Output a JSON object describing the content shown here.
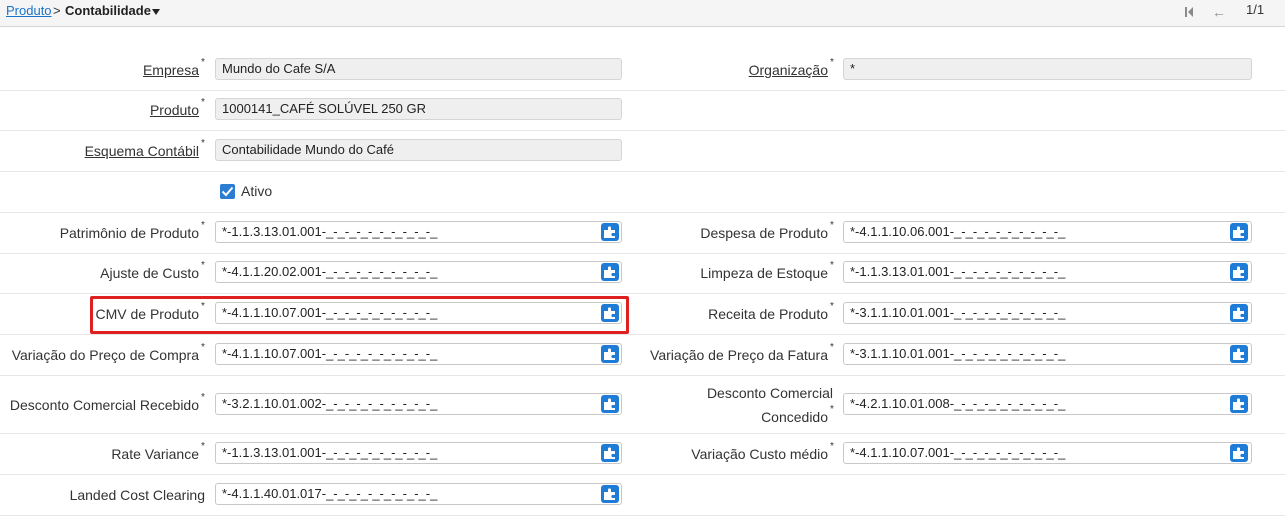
{
  "breadcrumb": {
    "root": "Produto",
    "separator": ">",
    "current": "Contabilidade"
  },
  "pager": {
    "text": "1/1"
  },
  "fields": {
    "empresa": {
      "label": "Empresa",
      "value": "Mundo do Cafe S/A"
    },
    "organizacao": {
      "label": "Organização",
      "value": "*"
    },
    "produto": {
      "label": "Produto",
      "value": "1000141_CAFÉ SOLÚVEL 250 GR"
    },
    "esquema": {
      "label": "Esquema Contábil",
      "value": "Contabilidade Mundo do Café"
    },
    "ativo": {
      "label": "Ativo",
      "checked": true
    },
    "patrimonio": {
      "label": "Patrimônio de Produto",
      "value": "*-1.1.3.13.01.001-_-_-_-_-_-_-_-_-_-_"
    },
    "despesa": {
      "label": "Despesa de Produto",
      "value": "*-4.1.1.10.06.001-_-_-_-_-_-_-_-_-_-_"
    },
    "ajuste": {
      "label": "Ajuste de Custo",
      "value": "*-4.1.1.20.02.001-_-_-_-_-_-_-_-_-_-_"
    },
    "limpeza": {
      "label": "Limpeza de Estoque",
      "value": "*-1.1.3.13.01.001-_-_-_-_-_-_-_-_-_-_"
    },
    "cmv": {
      "label": "CMV de Produto",
      "value": "*-4.1.1.10.07.001-_-_-_-_-_-_-_-_-_-_"
    },
    "receita": {
      "label": "Receita de Produto",
      "value": "*-3.1.1.10.01.001-_-_-_-_-_-_-_-_-_-_"
    },
    "var_compra": {
      "label": "Variação do Preço de Compra",
      "value": "*-4.1.1.10.07.001-_-_-_-_-_-_-_-_-_-_"
    },
    "var_fatura": {
      "label": "Variação de Preço da Fatura",
      "value": "*-3.1.1.10.01.001-_-_-_-_-_-_-_-_-_-_"
    },
    "desc_recebido": {
      "label": "Desconto Comercial Recebido",
      "value": "*-3.2.1.10.01.002-_-_-_-_-_-_-_-_-_-_"
    },
    "desc_concedido": {
      "label_line1": "Desconto Comercial",
      "label_line2": "Concedido",
      "value": "*-4.2.1.10.01.008-_-_-_-_-_-_-_-_-_-_"
    },
    "rate_variance": {
      "label": "Rate Variance",
      "value": "*-1.1.3.13.01.001-_-_-_-_-_-_-_-_-_-_"
    },
    "custo_medio": {
      "label": "Variação Custo médio",
      "value": "*-4.1.1.10.07.001-_-_-_-_-_-_-_-_-_-_"
    },
    "landed": {
      "label": "Landed Cost Clearing",
      "value": "*-4.1.1.40.01.017-_-_-_-_-_-_-_-_-_-_"
    }
  },
  "required_marker": "*",
  "colors": {
    "accent": "#1e7bd6",
    "highlight": "#e02020"
  },
  "icons": {
    "account_button": "puzzle-icon",
    "checkbox": "checkmark-icon"
  }
}
